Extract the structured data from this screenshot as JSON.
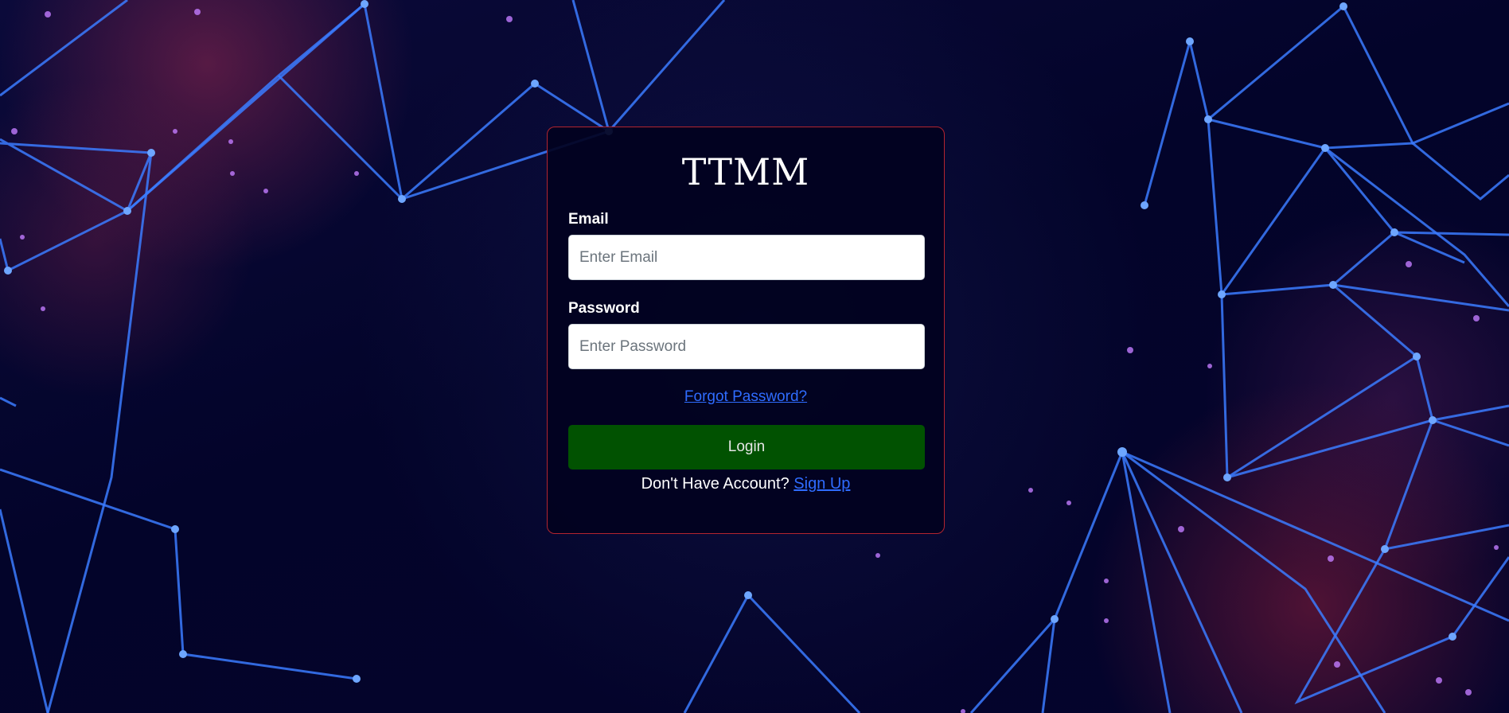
{
  "app": {
    "title": "TTMM"
  },
  "form": {
    "email_label": "Email",
    "email_placeholder": "Enter Email",
    "email_value": "",
    "password_label": "Password",
    "password_placeholder": "Enter Password",
    "password_value": "",
    "forgot_password_link": "Forgot Password?",
    "login_button": "Login",
    "signup_prompt": "Don't Have Account?",
    "signup_link": "Sign Up"
  },
  "colors": {
    "background": "#03042a",
    "card_border": "#b3242f",
    "login_button": "#015201",
    "link": "#2f6cff",
    "network_lines": "#3b7bff"
  }
}
